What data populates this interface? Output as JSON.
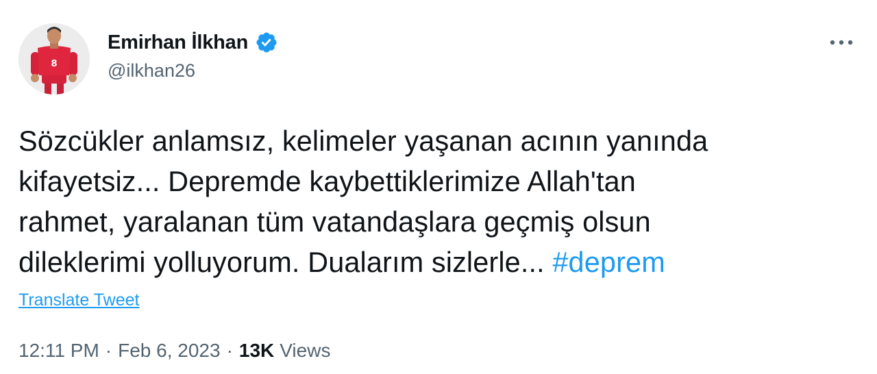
{
  "author": {
    "display_name": "Emirhan İlkhan",
    "handle": "@ilkhan26",
    "verified": true,
    "avatar_icon": "player-avatar",
    "jersey_number": "8"
  },
  "menu": {
    "icon": "more-horizontal-icon"
  },
  "tweet": {
    "lines": [
      "Sözcükler anlamsız, kelimeler yaşanan acının yanında",
      "kifayetsiz... Depremde kaybettiklerimize Allah'tan",
      "rahmet, yaralanan tüm vatandaşlara geçmiş olsun",
      "dileklerimi yolluyorum. Dualarım sizlerle... "
    ],
    "hashtag": "#deprem"
  },
  "translate_label": "Translate Tweet",
  "meta": {
    "time": "12:11 PM",
    "separator": "·",
    "date": "Feb 6, 2023",
    "views_count": "13K",
    "views_label": "Views"
  },
  "colors": {
    "accent": "#1d9bf0",
    "text": "#0f1419",
    "muted": "#536471"
  }
}
